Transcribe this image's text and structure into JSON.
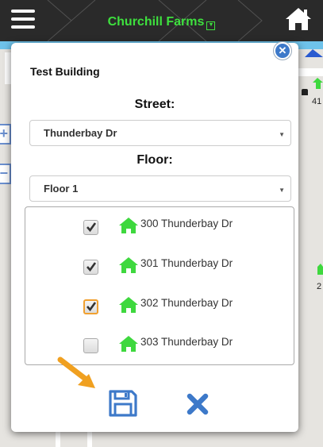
{
  "header": {
    "title": "Churchill Farms"
  },
  "map": {
    "labels": [
      "41",
      "2"
    ]
  },
  "dialog": {
    "title": "Test Building",
    "street_label": "Street:",
    "street_value": "Thunderbay Dr",
    "floor_label": "Floor:",
    "floor_value": "Floor 1",
    "units": [
      {
        "label": "300 Thunderbay Dr",
        "checked": true
      },
      {
        "label": "301 Thunderbay Dr",
        "checked": true
      },
      {
        "label": "302 Thunderbay Dr",
        "checked": true
      },
      {
        "label": "303 Thunderbay Dr",
        "checked": false
      }
    ]
  },
  "colors": {
    "topbar": "#2a2a2a",
    "title_green": "#3ee03e",
    "house_green": "#3ed83e",
    "accent_blue": "#3d79c9",
    "arrow_orange": "#f0a020"
  },
  "icons": [
    "menu-icon",
    "home-icon",
    "close-icon",
    "house-icon",
    "checkmark-icon",
    "save-icon",
    "cancel-icon",
    "pointer-arrow-icon"
  ]
}
